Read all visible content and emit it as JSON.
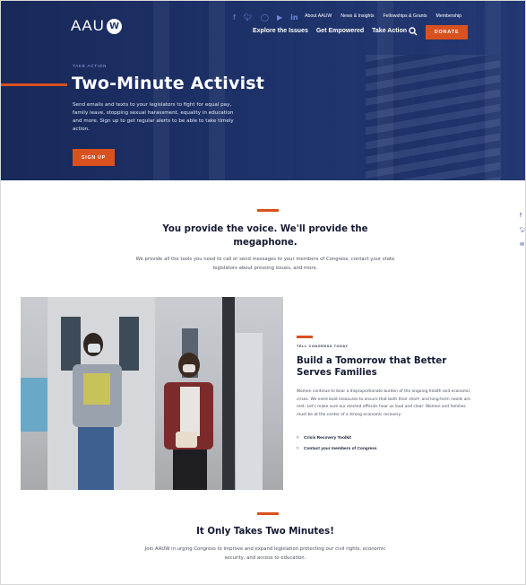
{
  "header": {
    "logo_text": "AAU",
    "logo_mark": "W",
    "social_icons": [
      "facebook-icon",
      "twitter-icon",
      "instagram-icon",
      "youtube-icon",
      "linkedin-icon"
    ],
    "utility_nav": [
      "About AAUW",
      "News & Insights",
      "Fellowships & Grants",
      "Membership"
    ],
    "main_nav": [
      "Explore the Issues",
      "Get Empowered",
      "Take Action"
    ],
    "donate_label": "DONATE"
  },
  "hero": {
    "eyebrow": "TAKE ACTION",
    "title": "Two-Minute Activist",
    "description": "Send emails and texts to your legislators to fight for equal pay, family leave, stopping sexual harassment, equality in education and more. Sign up to get regular alerts to be able to take timely action.",
    "cta_label": "SIGN UP"
  },
  "section_voice": {
    "title": "You provide the voice. We'll provide the megaphone.",
    "description": "We provide all the tools you need to call or send messages to your members of Congress, contact your state legislators about pressing issues, and more."
  },
  "section_congress": {
    "eyebrow": "TELL CONGRESS TODAY",
    "title": "Build a Tomorrow that Better Serves Families",
    "description": "Women continue to bear a disproportionate burden of the ongoing health and economic crises. We need bold measures to ensure that both their short- and long-term needs are met. Let's make sure our elected officials hear us loud and clear: Women and families must be at the center of a strong economic recovery.",
    "links": [
      "Crisis Recovery Toolkit",
      "Contact your members of Congress"
    ]
  },
  "section_two_minutes": {
    "title": "It Only Takes Two Minutes!",
    "description": "Join AAUW in urging Congress to improve and expand legislation protecting our civil rights, economic security, and access to education."
  },
  "share": {
    "icons": [
      "facebook-icon",
      "twitter-icon",
      "email-icon"
    ]
  },
  "colors": {
    "navy": "#1f3576",
    "accent": "#d9511f",
    "link_chevron": "#2c5fcf"
  }
}
